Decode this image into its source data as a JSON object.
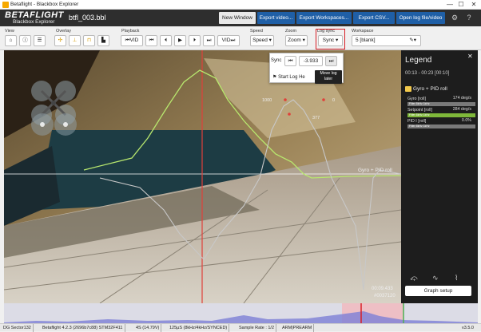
{
  "window": {
    "title": "Betaflight - Blackbox Explorer",
    "minimize": "—",
    "maximize": "☐",
    "close": "✕"
  },
  "header": {
    "logo_main": "BETAFLIGHT",
    "logo_sub": "Blackbox Explorer",
    "filename": "btfl_003.bbl",
    "buttons": {
      "new_window": "New Window",
      "export_video": "Export video...",
      "export_workspaces": "Export Workspaces...",
      "export_csv": "Export CSV...",
      "open_log": "Open log file/video"
    },
    "settings_icon": "gear-icon",
    "help_icon": "question-icon"
  },
  "toolbar": {
    "groups": {
      "view": "View",
      "overlay": "Overlay",
      "playback": "Playback",
      "speed": "Speed",
      "zoom": "Zoom",
      "log_sync": "Log sync",
      "workspace": "Workspace"
    },
    "speed_label": "Speed ▾",
    "zoom_label": "Zoom ▾",
    "sync_label": "Sync ▾",
    "vid_label": "VID",
    "workspace_value": "5 [blank]"
  },
  "sync_popup": {
    "label": "Sync",
    "offset_value": "-3.933",
    "start_log_here": "Start Log He",
    "tooltip": [
      "Move log",
      "later"
    ]
  },
  "graph": {
    "label_1000": "1000",
    "label_0": "0",
    "label_377": "377",
    "trace_label": "Gyro + PID roll",
    "time": "00:09.433",
    "frame": "#0037120",
    "colors": {
      "gyro": "#b8e86e",
      "setpoint": "#c8c8c8",
      "cursor": "#e0403a"
    }
  },
  "legend": {
    "title": "Legend",
    "range": "00:13 - 00:23 [00:10]",
    "group_name": "Gyro + PID roll",
    "rows": [
      {
        "name": "Gyro [roll]",
        "value": "174 deg/s",
        "filter": "Filter 8kHz 1kHz"
      },
      {
        "name": "Setpoint [roll]",
        "value": "284 deg/s",
        "filter": "Filter 8kHz 1kHz"
      },
      {
        "name": "PID I [roll]",
        "value": "0.0%",
        "filter": "Filter 8kHz 1kHz"
      }
    ],
    "graph_setup": "Graph setup"
  },
  "statusbar": {
    "items": [
      "DG Sector132",
      "Betaflight 4.2.3 (2696b7c88) STM32F411",
      "4S (14.79V)",
      "125µS (8kHz/4kHz/SYNCED)",
      "Sample Rate : 1/2",
      "ARM|PREARM"
    ],
    "version": "v3.5.0"
  }
}
